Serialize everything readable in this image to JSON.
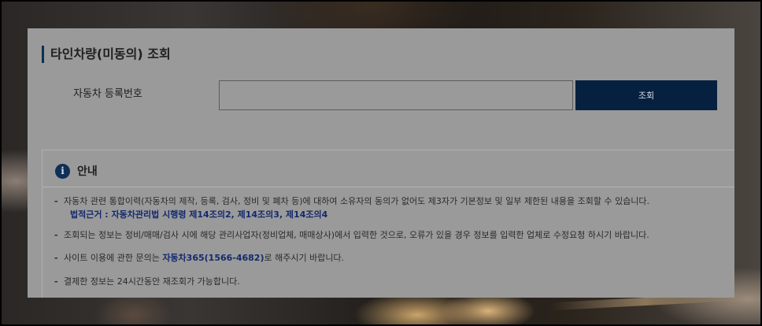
{
  "page": {
    "title": "타인차량(미동의) 조회"
  },
  "search": {
    "label": "자동차 등록번호",
    "input_value": "",
    "button_label": "조회"
  },
  "notice": {
    "icon": "info-icon",
    "icon_glyph": "i",
    "title": "안내",
    "items": [
      {
        "text": "자동차 관련 통합이력(자동차의 제작, 등록, 검사, 정비 및 폐차 등)에 대하여 소유자의 동의가 없어도 제3자가 기본정보 및 일부 제한된 내용을 조회할 수 있습니다.",
        "sub": "법적근거 : 자동차관리법 시행령 제14조의2, 제14조의3, 제14조의4"
      },
      {
        "text": "조회되는 정보는 정비/매매/검사 시에 해당 관리사업자(정비업체, 매매상사)에서 입력한 것으로, 오류가 있을 경우 정보를 입력한 업체로 수정요청 하시기 바랍니다."
      },
      {
        "text_before": "사이트 이용에 관한 문의는 ",
        "link": "자동차365(1566-4682)",
        "text_after": "로 해주시기 바랍니다."
      },
      {
        "text": "결제한 정보는 24시간동안 재조회가 가능합니다."
      }
    ]
  },
  "colors": {
    "accent": "#0e2f56",
    "button": "#06213f",
    "overlay": "#9a9a9a",
    "link": "#13296e"
  }
}
